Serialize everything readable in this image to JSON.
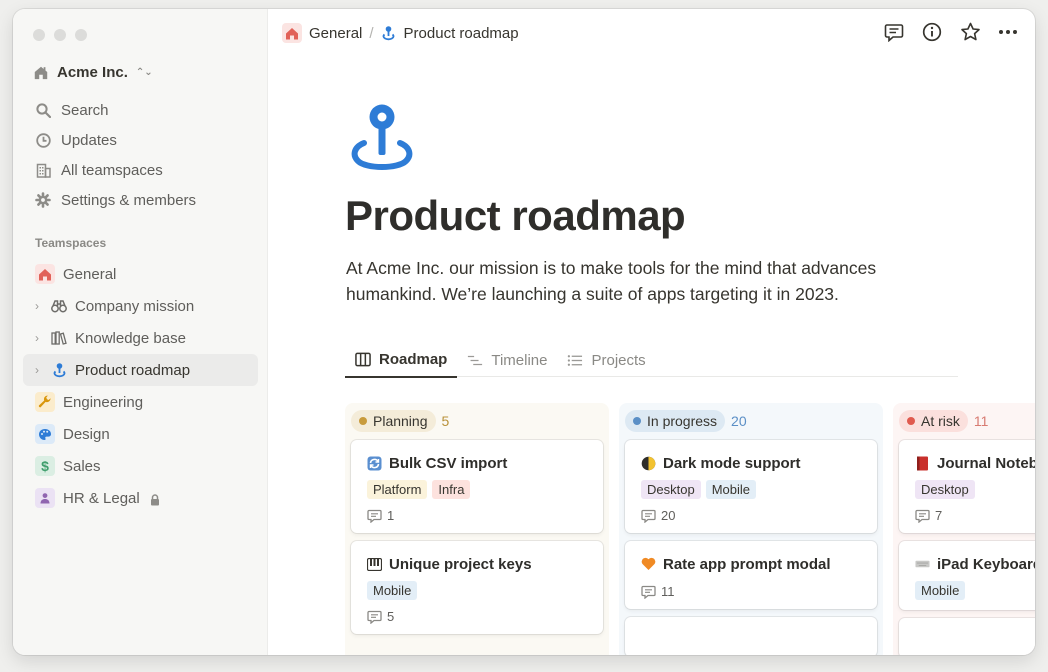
{
  "sidebar": {
    "workspace": "Acme Inc.",
    "nav": [
      {
        "label": "Search",
        "icon": "search-icon"
      },
      {
        "label": "Updates",
        "icon": "clock-icon"
      },
      {
        "label": "All teamspaces",
        "icon": "building-icon"
      },
      {
        "label": "Settings & members",
        "icon": "gear-icon"
      }
    ],
    "section_label": "Teamspaces",
    "teamspaces": [
      {
        "label": "General",
        "icon": "house-icon",
        "color": "#e16259"
      },
      {
        "label": "Company mission",
        "icon": "binoculars-icon"
      },
      {
        "label": "Knowledge base",
        "icon": "books-icon"
      },
      {
        "label": "Product roadmap",
        "icon": "location-pin-icon",
        "color": "#2e7cd6"
      },
      {
        "label": "Engineering",
        "icon": "wrench-icon",
        "color": "#dfab01"
      },
      {
        "label": "Design",
        "icon": "palette-icon",
        "color": "#2e7cd6"
      },
      {
        "label": "Sales",
        "icon": "dollar-icon",
        "color": "#3f9e6c"
      },
      {
        "label": "HR & Legal",
        "icon": "person-icon",
        "color": "#9065b0"
      }
    ]
  },
  "breadcrumb": {
    "parent": "General",
    "current": "Product roadmap"
  },
  "page": {
    "title": "Product roadmap",
    "description": "At Acme Inc. our mission is to make tools for the mind that advances humankind. We’re launching a suite of apps targeting it in 2023."
  },
  "tabs": [
    {
      "label": "Roadmap",
      "icon": "board-icon"
    },
    {
      "label": "Timeline",
      "icon": "timeline-icon"
    },
    {
      "label": "Projects",
      "icon": "list-icon"
    }
  ],
  "board": {
    "columns": [
      {
        "name": "Planning",
        "count": "5",
        "bg": "#fbf9f3",
        "pill_bg": "#f4ecd9",
        "dot": "#c89b3c",
        "count_color": "#b8913a",
        "cards": [
          {
            "title": "Bulk CSV import",
            "icon": "sync-icon",
            "tags": [
              {
                "label": "Platform",
                "bg": "#fbf3db"
              },
              {
                "label": "Infra",
                "bg": "#fde2de"
              }
            ],
            "comments": "1"
          },
          {
            "title": "Unique project keys",
            "icon": "piano-icon",
            "tags": [
              {
                "label": "Mobile",
                "bg": "#e3eef7"
              }
            ],
            "comments": "5"
          }
        ]
      },
      {
        "name": "In progress",
        "count": "20",
        "bg": "#f4f8fb",
        "pill_bg": "#dde9f3",
        "dot": "#5b8fc6",
        "count_color": "#5b8fc6",
        "cards": [
          {
            "title": "Dark mode support",
            "icon": "half-moon-icon",
            "tags": [
              {
                "label": "Desktop",
                "bg": "#efe5f5"
              },
              {
                "label": "Mobile",
                "bg": "#e3eef7"
              }
            ],
            "comments": "20"
          },
          {
            "title": "Rate app prompt modal",
            "icon": "heart-icon",
            "tags": [],
            "comments": "11"
          }
        ]
      },
      {
        "name": "At risk",
        "count": "11",
        "bg": "#fdf5f4",
        "pill_bg": "#fbe0dd",
        "dot": "#e05a4e",
        "count_color": "#d87b72",
        "cards": [
          {
            "title": "Journal Noteb",
            "icon": "book-icon",
            "tags": [
              {
                "label": "Desktop",
                "bg": "#efe5f5"
              }
            ],
            "comments": "7"
          },
          {
            "title": "iPad Keyboard",
            "icon": "keyboard-icon",
            "tags": [
              {
                "label": "Mobile",
                "bg": "#e3eef7"
              }
            ],
            "comments": ""
          }
        ]
      }
    ]
  },
  "colors": {
    "sidebar_bg": "#f7f7f5",
    "accent_blue": "#2e7cd6"
  }
}
